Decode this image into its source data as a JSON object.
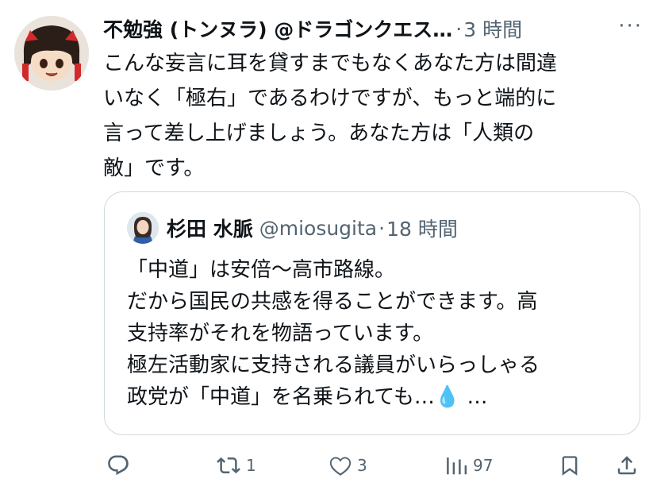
{
  "tweet": {
    "display_name": "不勉強 (トンヌラ) @ドラゴンクエス…",
    "separator": "·",
    "time": "3 時間",
    "more_label": "···",
    "text": "こんな妄言に耳を貸すまでもなくあなた方は間違\nいなく「極右」であるわけですが、もっと端的に\n言って差し上げましょう。あなた方は「人類の\n敵」です。"
  },
  "quote": {
    "name": "杉田 水脈",
    "handle": "@miosugita",
    "separator": "·",
    "time": "18 時間",
    "text": "「中道」は安倍〜高市路線。\nだから国民の共感を得ることができます。高\n支持率がそれを物語っています。\n極左活動家に支持される議員がいらっしゃる\n政党が「中道」を名乗られても…",
    "drop_icon_char": "💧",
    "truncation": " …"
  },
  "actions": {
    "reply_count": "",
    "retweet_count": "1",
    "like_count": "3",
    "views_count": "97"
  },
  "colors": {
    "text": "#0f1419",
    "secondary": "#536471",
    "border": "#cfd9de",
    "accent": "#1d9bf0"
  }
}
